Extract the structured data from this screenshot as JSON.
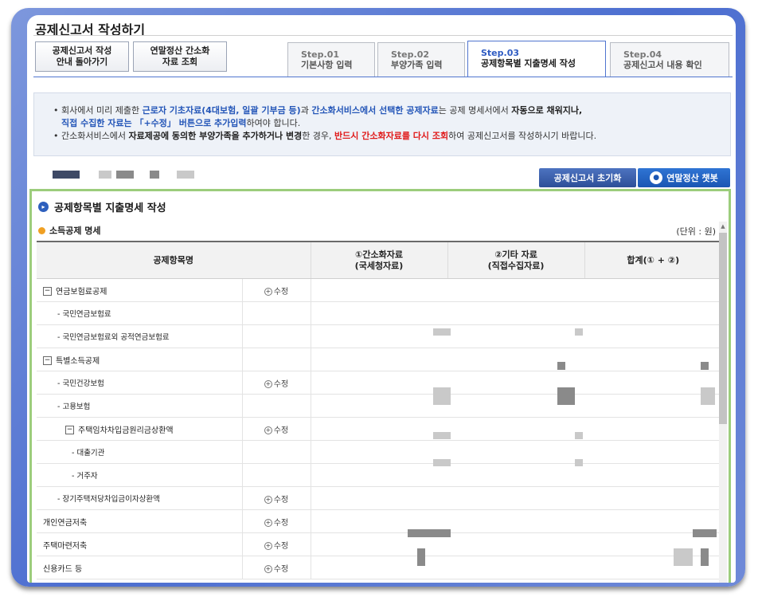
{
  "page": {
    "title": "공제신고서 작성하기"
  },
  "buttons": {
    "back_line1": "공제신고서 작성",
    "back_line2": "안내 돌아가기",
    "lookup_line1": "연말정산 간소화",
    "lookup_line2": "자료 조회",
    "reset": "공제신고서 초기화",
    "chatbot": "연말정산 챗봇"
  },
  "steps": [
    {
      "num": "Step.01",
      "label": "기본사항 입력"
    },
    {
      "num": "Step.02",
      "label": "부양가족 입력"
    },
    {
      "num": "Step.03",
      "label": "공제항목별 지출명세 작성"
    },
    {
      "num": "Step.04",
      "label": "공제신고서 내용 확인"
    }
  ],
  "notice": {
    "l1_a": "회사에서 미리 제출한 ",
    "l1_b": "근로자 기초자료(4대보험, 일괄 기부금 등)",
    "l1_c": "과 ",
    "l1_d": "간소화서비스에서 선택한 공제자료",
    "l1_e": "는 공제 명세서에서 ",
    "l1_f": "자동으로 채워지나,",
    "l2_a": "직접 수집한 자료는 「+수정」 버튼으로 추가입력",
    "l2_b": "하여야 합니다.",
    "l3_a": "간소화서비스에서 ",
    "l3_b": "자료제공에 동의한 부양가족을 추가하거나 변경",
    "l3_c": "한 경우, ",
    "l3_d": "반드시 간소화자료를 다시 조회",
    "l3_e": "하여 공제신고서를 작성하시기 바랍니다."
  },
  "section": {
    "title": "공제항목별 지출명세 작성",
    "subtitle": "소득공제 명세",
    "unit": "(단위 : 원)"
  },
  "table": {
    "headers": [
      "공제항목명",
      "①간소화자료\n(국세청자료)",
      "②기타 자료\n(직접수집자료)",
      "합계(① + ②)"
    ],
    "edit_label": "수정",
    "rows": [
      {
        "name": "연금보험료공제",
        "level": 0,
        "toggle": true,
        "edit": true
      },
      {
        "name": "- 국민연금보험료",
        "level": 1,
        "toggle": false,
        "edit": false
      },
      {
        "name": "- 국민연금보험료외 공적연금보험료",
        "level": 1,
        "toggle": false,
        "edit": false
      },
      {
        "name": "특별소득공제",
        "level": 0,
        "toggle": true,
        "edit": false
      },
      {
        "name": "- 국민건강보험",
        "level": 1,
        "toggle": false,
        "edit": true
      },
      {
        "name": "- 고용보험",
        "level": 1,
        "toggle": false,
        "edit": false
      },
      {
        "name": "주택임차차입금원리금상환액",
        "level": 2,
        "toggle": true,
        "edit": true
      },
      {
        "name": "- 대출기관",
        "level": 3,
        "toggle": false,
        "edit": false
      },
      {
        "name": "- 거주자",
        "level": 3,
        "toggle": false,
        "edit": false
      },
      {
        "name": "- 장기주택저당차입금이자상환액",
        "level": 1,
        "toggle": false,
        "edit": true
      },
      {
        "name": "개인연금저축",
        "level": 0,
        "toggle": false,
        "edit": true
      },
      {
        "name": "주택마련저축",
        "level": 0,
        "toggle": false,
        "edit": true
      },
      {
        "name": "신용카드 등",
        "level": 0,
        "toggle": false,
        "edit": true
      }
    ]
  }
}
